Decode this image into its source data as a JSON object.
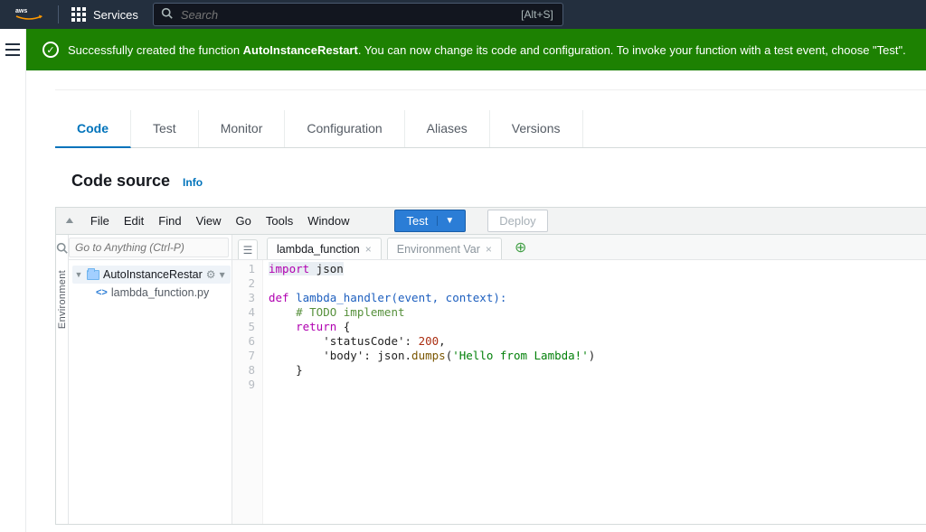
{
  "topbar": {
    "services_label": "Services",
    "search_placeholder": "Search",
    "search_shortcut": "[Alt+S]"
  },
  "banner": {
    "prefix": "Successfully created the function ",
    "function_name": "AutoInstanceRestart",
    "suffix": ". You can now change its code and configuration. To invoke your function with a test event, choose \"Test\"."
  },
  "tabs": {
    "code": "Code",
    "test": "Test",
    "monitor": "Monitor",
    "configuration": "Configuration",
    "aliases": "Aliases",
    "versions": "Versions"
  },
  "panel": {
    "title": "Code source",
    "info_label": "Info"
  },
  "ide_menu": {
    "file": "File",
    "edit": "Edit",
    "find": "Find",
    "view": "View",
    "go": "Go",
    "tools": "Tools",
    "window": "Window",
    "test_btn": "Test",
    "deploy_btn": "Deploy"
  },
  "ide": {
    "env_label": "Environment",
    "goto_placeholder": "Go to Anything (Ctrl-P)",
    "folder_name": "AutoInstanceRestar",
    "file_name": "lambda_function.py",
    "editor_tabs": {
      "main": "lambda_function",
      "second": "Environment Var"
    }
  },
  "code_lines": {
    "l1_import": "import",
    "l1_json": " json",
    "l3_def": "def",
    "l3_sig": " lambda_handler(event, context):",
    "l4_comment": "    # TODO implement",
    "l5_return": "    return",
    "l5_brace": " {",
    "l6": "        'statusCode': ",
    "l6_num": "200",
    "l6_comma": ",",
    "l7a": "        'body': json.",
    "l7_dumps": "dumps",
    "l7_paren": "(",
    "l7_str": "'Hello from Lambda!'",
    "l7_close": ")",
    "l8": "    }"
  }
}
